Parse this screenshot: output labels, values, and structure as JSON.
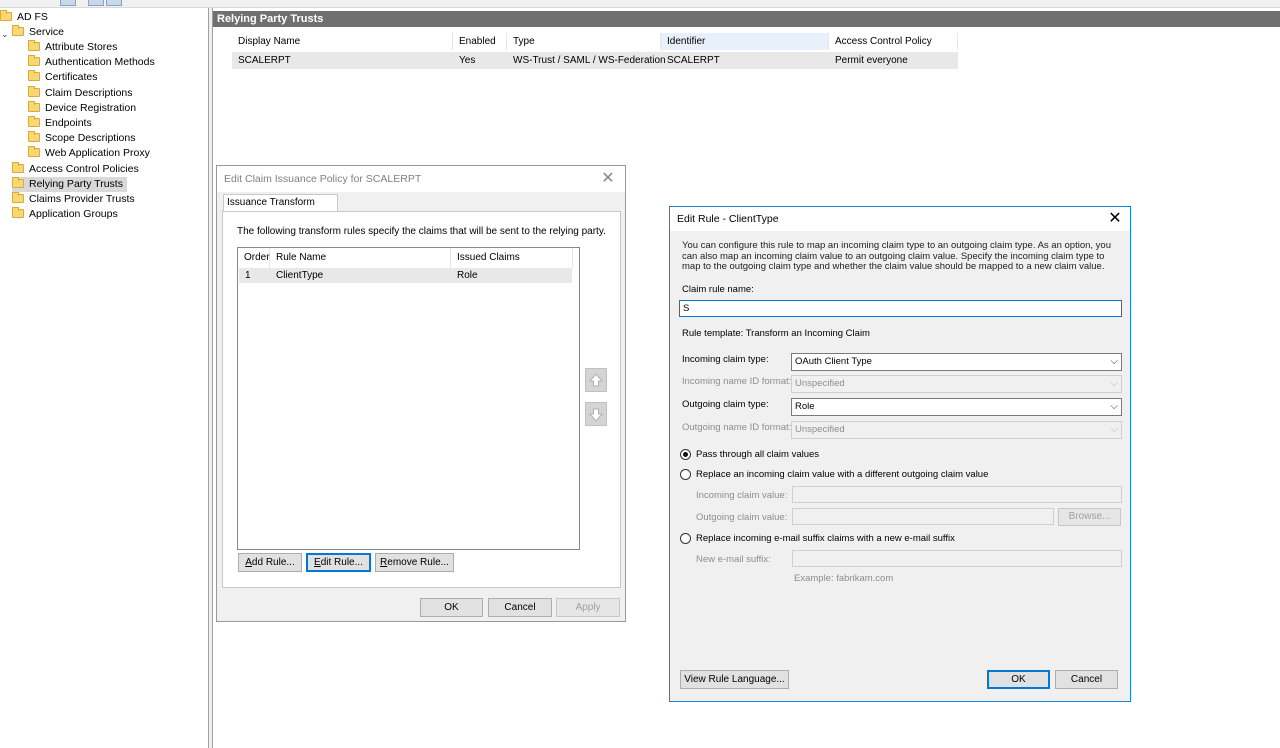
{
  "tree": {
    "root": "AD FS",
    "service": "Service",
    "service_children": [
      "Attribute Stores",
      "Authentication Methods",
      "Certificates",
      "Claim Descriptions",
      "Device Registration",
      "Endpoints",
      "Scope Descriptions",
      "Web Application Proxy"
    ],
    "top_items": [
      "Access Control Policies",
      "Relying Party Trusts",
      "Claims Provider Trusts",
      "Application Groups"
    ],
    "selected": "Relying Party Trusts"
  },
  "main": {
    "header": "Relying Party Trusts",
    "columns": [
      "Display Name",
      "Enabled",
      "Type",
      "Identifier",
      "Access Control Policy"
    ],
    "row": [
      "SCALERPT",
      "Yes",
      "WS-Trust / SAML / WS-Federation",
      "SCALERPT",
      "Permit everyone"
    ]
  },
  "claim_dialog": {
    "title": "Edit Claim Issuance Policy for SCALERPT",
    "tab": "Issuance Transform Rules",
    "description": "The following transform rules specify the claims that will be sent to the relying party.",
    "columns": [
      "Order",
      "Rule Name",
      "Issued Claims"
    ],
    "rule": {
      "order": "1",
      "name": "ClientType",
      "claims": "Role"
    },
    "add_rule": "Add Rule...",
    "edit_rule": "Edit Rule...",
    "remove_rule": "Remove Rule...",
    "ok": "OK",
    "cancel": "Cancel",
    "apply": "Apply"
  },
  "rule_dialog": {
    "title": "Edit Rule - ClientType",
    "description": "You can configure this rule to map an incoming claim type to an outgoing claim type. As an option, you can also map an incoming claim value to an outgoing claim value. Specify the incoming claim type to map to the outgoing claim type and whether the claim value should be mapped to a new claim value.",
    "rule_name_label": "Claim rule name:",
    "rule_name_value": "S",
    "template_label": "Rule template: Transform an Incoming Claim",
    "incoming_type_label": "Incoming claim type:",
    "incoming_type_value": "OAuth Client Type",
    "incoming_format_label": "Incoming name ID format:",
    "incoming_format_value": "Unspecified",
    "outgoing_type_label": "Outgoing claim type:",
    "outgoing_type_value": "Role",
    "outgoing_format_label": "Outgoing name ID format:",
    "outgoing_format_value": "Unspecified",
    "radio_pass": "Pass through all claim values",
    "radio_replace": "Replace an incoming claim value with a different outgoing claim value",
    "incoming_value_label": "Incoming claim value:",
    "outgoing_value_label": "Outgoing claim value:",
    "browse": "Browse...",
    "radio_email": "Replace incoming e-mail suffix claims with a new e-mail suffix",
    "email_label": "New e-mail suffix:",
    "email_example": "Example: fabrikam.com",
    "view_language": "View Rule Language...",
    "ok": "OK",
    "cancel": "Cancel"
  },
  "icons": {
    "close": "close-icon",
    "up": "arrow-up-icon",
    "down": "arrow-down-icon",
    "folder": "folder-icon"
  }
}
